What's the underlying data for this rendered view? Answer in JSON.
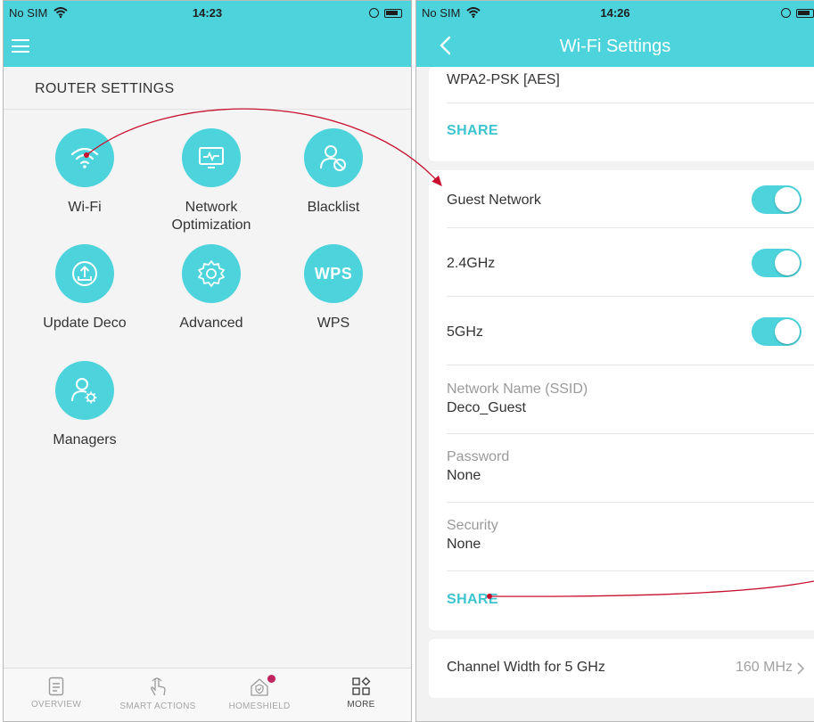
{
  "left_screen": {
    "status": {
      "carrier": "No SIM",
      "time": "14:23"
    },
    "section_title": "ROUTER SETTINGS",
    "tiles": [
      {
        "label": "Wi-Fi",
        "icon": "wifi-icon"
      },
      {
        "label": "Network Optimization",
        "icon": "network-optimization-icon"
      },
      {
        "label": "Blacklist",
        "icon": "blacklist-icon"
      },
      {
        "label": "Update Deco",
        "icon": "update-icon"
      },
      {
        "label": "Advanced",
        "icon": "gear-icon"
      },
      {
        "label": "WPS",
        "icon": "wps-icon",
        "icon_text": "WPS"
      },
      {
        "label": "Managers",
        "icon": "managers-icon"
      }
    ],
    "tabs": [
      {
        "label": "OVERVIEW",
        "icon": "document-icon"
      },
      {
        "label": "SMART ACTIONS",
        "icon": "hand-tap-icon"
      },
      {
        "label": "HOMESHIELD",
        "icon": "shield-house-icon"
      },
      {
        "label": "MORE",
        "icon": "grid-icon",
        "active": true
      }
    ]
  },
  "right_screen": {
    "status": {
      "carrier": "No SIM",
      "time": "14:26"
    },
    "title": "Wi-Fi Settings",
    "main_card": {
      "security_value": "WPA2-PSK [AES]",
      "share_label": "SHARE"
    },
    "guest_card": {
      "guest_network_label": "Guest Network",
      "guest_network_on": true,
      "band_24_label": "2.4GHz",
      "band_24_on": true,
      "band_5_label": "5GHz",
      "band_5_on": true,
      "ssid_label": "Network Name (SSID)",
      "ssid_value": "Deco_Guest",
      "password_label": "Password",
      "password_value": "None",
      "security_label": "Security",
      "security_value": "None",
      "share_label": "SHARE"
    },
    "channel_width": {
      "label": "Channel Width for 5 GHz",
      "value": "160 MHz"
    }
  },
  "colors": {
    "accent": "#4cd3dc",
    "share_text": "#3cc4cf",
    "annotation_arrow": "#c8102e",
    "badge": "#c0245e"
  }
}
